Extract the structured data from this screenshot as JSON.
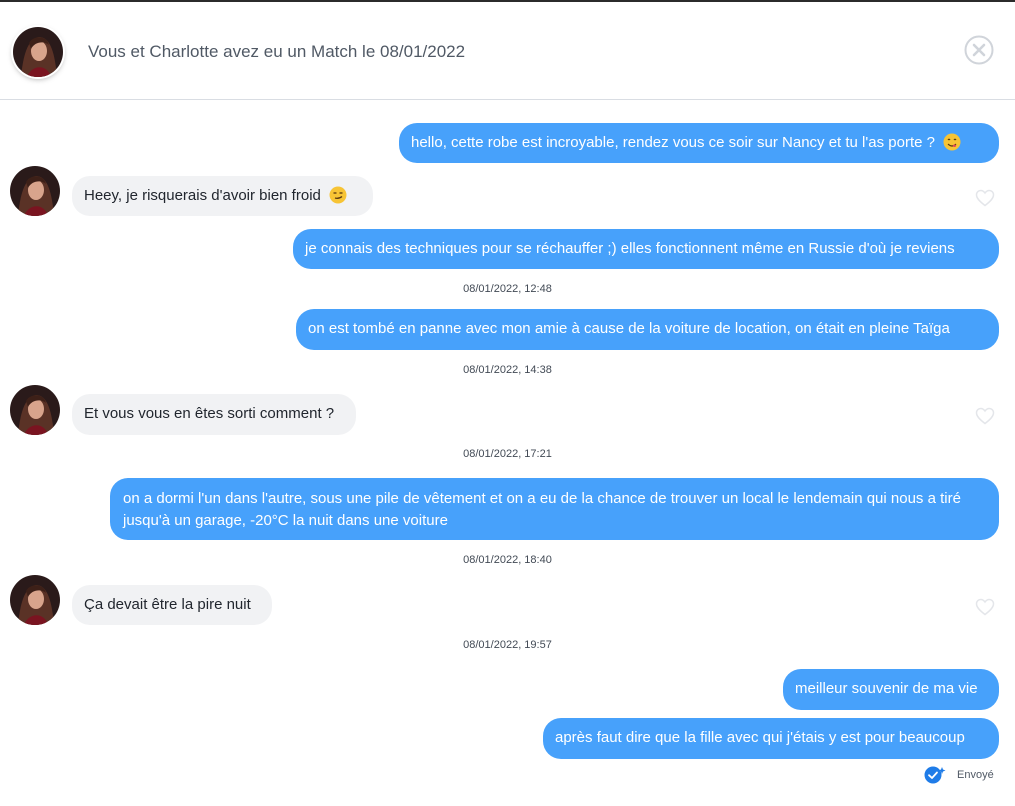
{
  "header": {
    "title": "Vous et Charlotte avez eu un Match le 08/01/2022",
    "avatar_alt": "Charlotte"
  },
  "messages": [
    {
      "direction": "out",
      "text": "hello, cette robe est incroyable, rendez vous ce soir sur Nancy et tu l'as porte ?",
      "emoji": "😋"
    },
    {
      "direction": "in",
      "text": "Heey, je risquerais d'avoir bien froid",
      "emoji": "😏"
    },
    {
      "direction": "out",
      "text": "je connais des techniques pour se réchauffer ;) elles fonctionnent même en Russie d'où je reviens"
    },
    {
      "direction": "timestamp",
      "text": "08/01/2022, 12:48"
    },
    {
      "direction": "out",
      "text": "on est tombé en panne avec mon amie à cause de la voiture de location, on était en pleine Taïga"
    },
    {
      "direction": "timestamp",
      "text": "08/01/2022, 14:38"
    },
    {
      "direction": "in",
      "text": "Et vous vous en êtes sorti comment ?"
    },
    {
      "direction": "timestamp",
      "text": "08/01/2022, 17:21"
    },
    {
      "direction": "out",
      "text": "on a dormi l'un dans l'autre, sous une pile de vêtement et on a eu de la chance de trouver un local le lendemain qui nous a tiré jusqu'à un garage, -20°C la nuit dans une voiture"
    },
    {
      "direction": "timestamp",
      "text": "08/01/2022, 18:40"
    },
    {
      "direction": "in",
      "text": "Ça devait être la pire nuit"
    },
    {
      "direction": "timestamp",
      "text": "08/01/2022, 19:57"
    },
    {
      "direction": "out",
      "text": "meilleur souvenir de ma vie"
    },
    {
      "direction": "out",
      "text": "après faut dire que la fille avec qui j'étais y est pour beaucoup"
    }
  ],
  "status": {
    "sent_label": "Envoyé"
  },
  "colors": {
    "outgoing_bubble": "#47a1fb",
    "incoming_bubble": "#f1f2f4",
    "sent_check": "#1f7ce8"
  },
  "icons": {
    "close": "close-icon",
    "like": "heart-icon",
    "sent": "double-check-icon"
  }
}
